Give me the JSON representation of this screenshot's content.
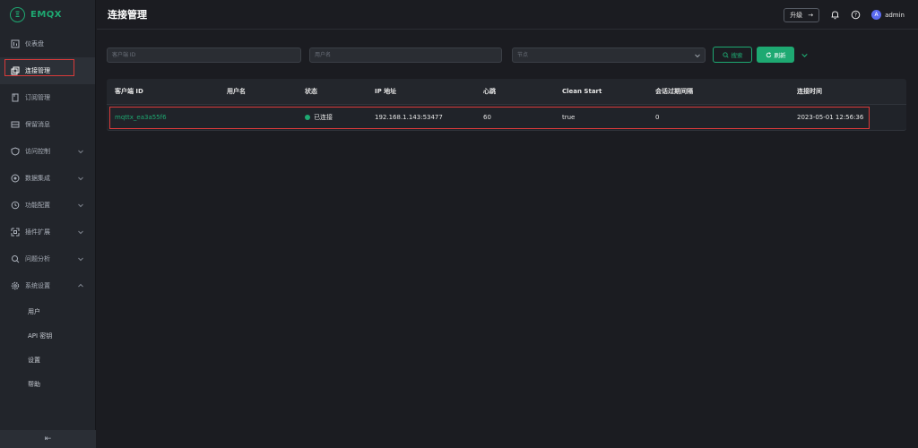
{
  "app": {
    "logo_text": "EMQX"
  },
  "sidebar": {
    "items": [
      {
        "label": "仪表盘",
        "icon": "dashboard-icon",
        "expandable": false
      },
      {
        "label": "连接管理",
        "icon": "connections-icon",
        "expandable": false,
        "active": true
      },
      {
        "label": "订阅管理",
        "icon": "subscriptions-icon",
        "expandable": false
      },
      {
        "label": "保留消息",
        "icon": "retained-icon",
        "expandable": false
      },
      {
        "label": "访问控制",
        "icon": "shield-icon",
        "expandable": true
      },
      {
        "label": "数据集成",
        "icon": "integration-icon",
        "expandable": true
      },
      {
        "label": "功能配置",
        "icon": "config-icon",
        "expandable": true
      },
      {
        "label": "插件扩展",
        "icon": "plugin-icon",
        "expandable": true
      },
      {
        "label": "问题分析",
        "icon": "analysis-icon",
        "expandable": true
      },
      {
        "label": "系统设置",
        "icon": "settings-icon",
        "expandable": true,
        "expanded": true
      }
    ],
    "sub_items": [
      {
        "label": "用户"
      },
      {
        "label": "API 密钥"
      },
      {
        "label": "设置"
      },
      {
        "label": "帮助"
      }
    ],
    "collapse_icon": "collapse-icon"
  },
  "header": {
    "title": "连接管理",
    "upgrade_label": "升级",
    "upgrade_arrow": "→",
    "user_initial": "A",
    "user_name": "admin"
  },
  "filters": {
    "client_id_placeholder": "客户端 ID",
    "username_placeholder": "用户名",
    "node_placeholder": "节点",
    "search_label": "搜索",
    "refresh_label": "刷新"
  },
  "table": {
    "columns": [
      "客户端 ID",
      "用户名",
      "状态",
      "IP 地址",
      "心跳",
      "Clean Start",
      "会话过期间隔",
      "连接时间"
    ],
    "rows": [
      {
        "client_id": "mqttx_ea3a55f6",
        "username": "",
        "status": "已连接",
        "ip": "192.168.1.143:53477",
        "keepalive": "60",
        "clean_start": "true",
        "expiry": "0",
        "connected_at": "2023-05-01 12:56:36"
      }
    ]
  },
  "colors": {
    "accent": "#1ea972",
    "highlight": "#d93a3a",
    "background": "#1b1c21",
    "sidebar": "#22252b"
  }
}
